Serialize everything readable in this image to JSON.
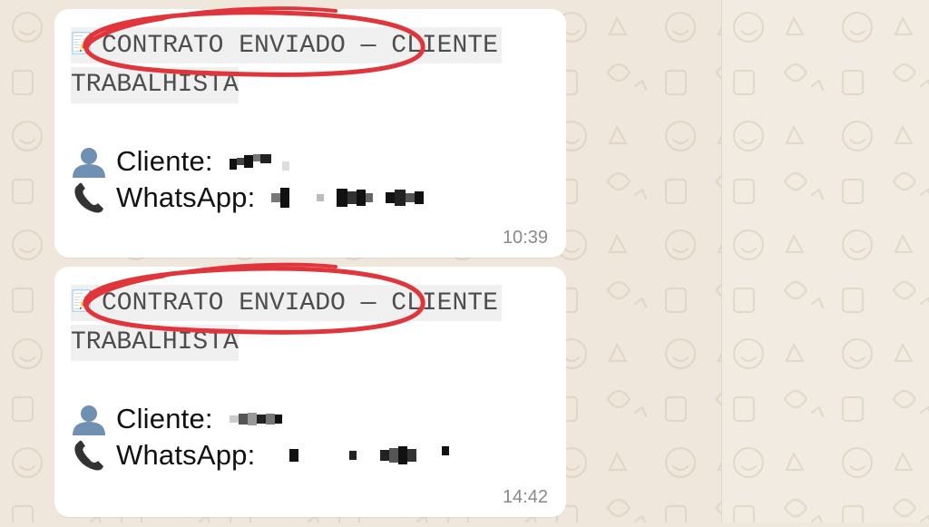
{
  "messages": [
    {
      "header_line1": "CONTRATO ENVIADO — CLIENTE",
      "header_line2": "TRABALHISTA",
      "client_label": "Cliente:",
      "whatsapp_label": "WhatsApp:",
      "time": "10:39"
    },
    {
      "header_line1": "CONTRATO ENVIADO — CLIENTE",
      "header_line2": "TRABALHISTA",
      "client_label": "Cliente:",
      "whatsapp_label": "WhatsApp:",
      "time": "14:42"
    }
  ],
  "icons": {
    "memo": "memo-icon",
    "person": "bust-in-silhouette-icon",
    "phone": "telephone-receiver-icon"
  },
  "colors": {
    "annotation_circle": "#e0353b",
    "bubble": "#ffffff",
    "wallpaper": "#efe7dc"
  }
}
